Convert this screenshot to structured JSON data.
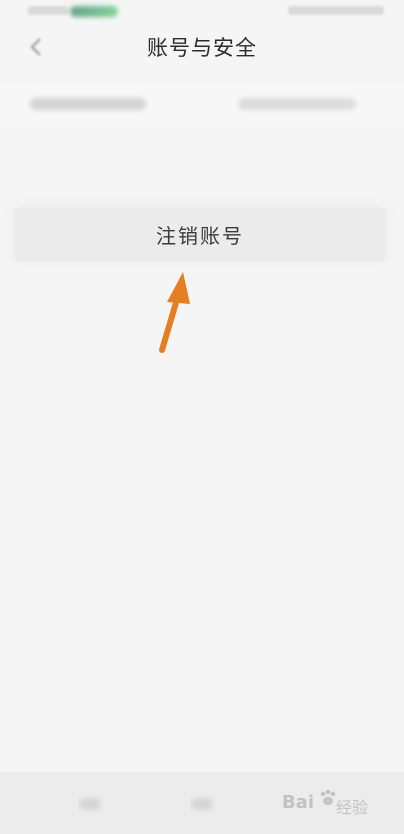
{
  "header": {
    "title": "账号与安全"
  },
  "actions": {
    "delete_account_label": "注销账号"
  },
  "icons": {
    "back": "back-arrow-icon",
    "annotation_arrow": "arrow-icon",
    "watermark_paw": "paw-icon"
  },
  "colors": {
    "annotation_arrow": "#e67e22",
    "background": "#f5f5f5",
    "button_bg": "#ebebeb"
  },
  "watermark": {
    "brand": "Bai",
    "suffix": "经验"
  }
}
